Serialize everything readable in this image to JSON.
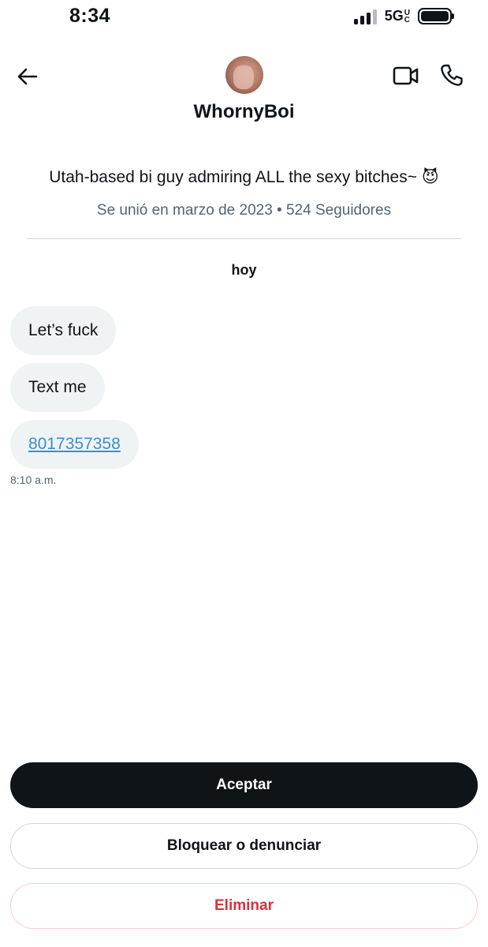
{
  "status_bar": {
    "time": "8:34",
    "network": "5G",
    "network_suffix_top": "U",
    "network_suffix_bottom": "C",
    "signal_bars": 3,
    "battery_level": 1.0
  },
  "header": {
    "username": "WhornyBoi",
    "back_icon": "arrow-left-icon",
    "video_icon": "video-call-icon",
    "phone_icon": "phone-icon"
  },
  "profile": {
    "bio": "Utah-based bi guy admiring ALL the sexy bitches~ 😈",
    "meta": "Se unió en marzo de 2023 • 524 Seguidores"
  },
  "conversation": {
    "day_label": "hoy",
    "messages": [
      {
        "text": "Let’s fuck"
      },
      {
        "text": "Text me"
      },
      {
        "text": "8017357358",
        "is_link": true
      }
    ],
    "timestamp": "8:10 a.m."
  },
  "actions": {
    "accept": "Aceptar",
    "block_report": "Bloquear o denunciar",
    "delete": "Eliminar"
  },
  "colors": {
    "text": "#0f1419",
    "secondary": "#536471",
    "bubble_bg": "#eff3f4",
    "link": "#3b8ed0",
    "danger": "#d3333c"
  }
}
